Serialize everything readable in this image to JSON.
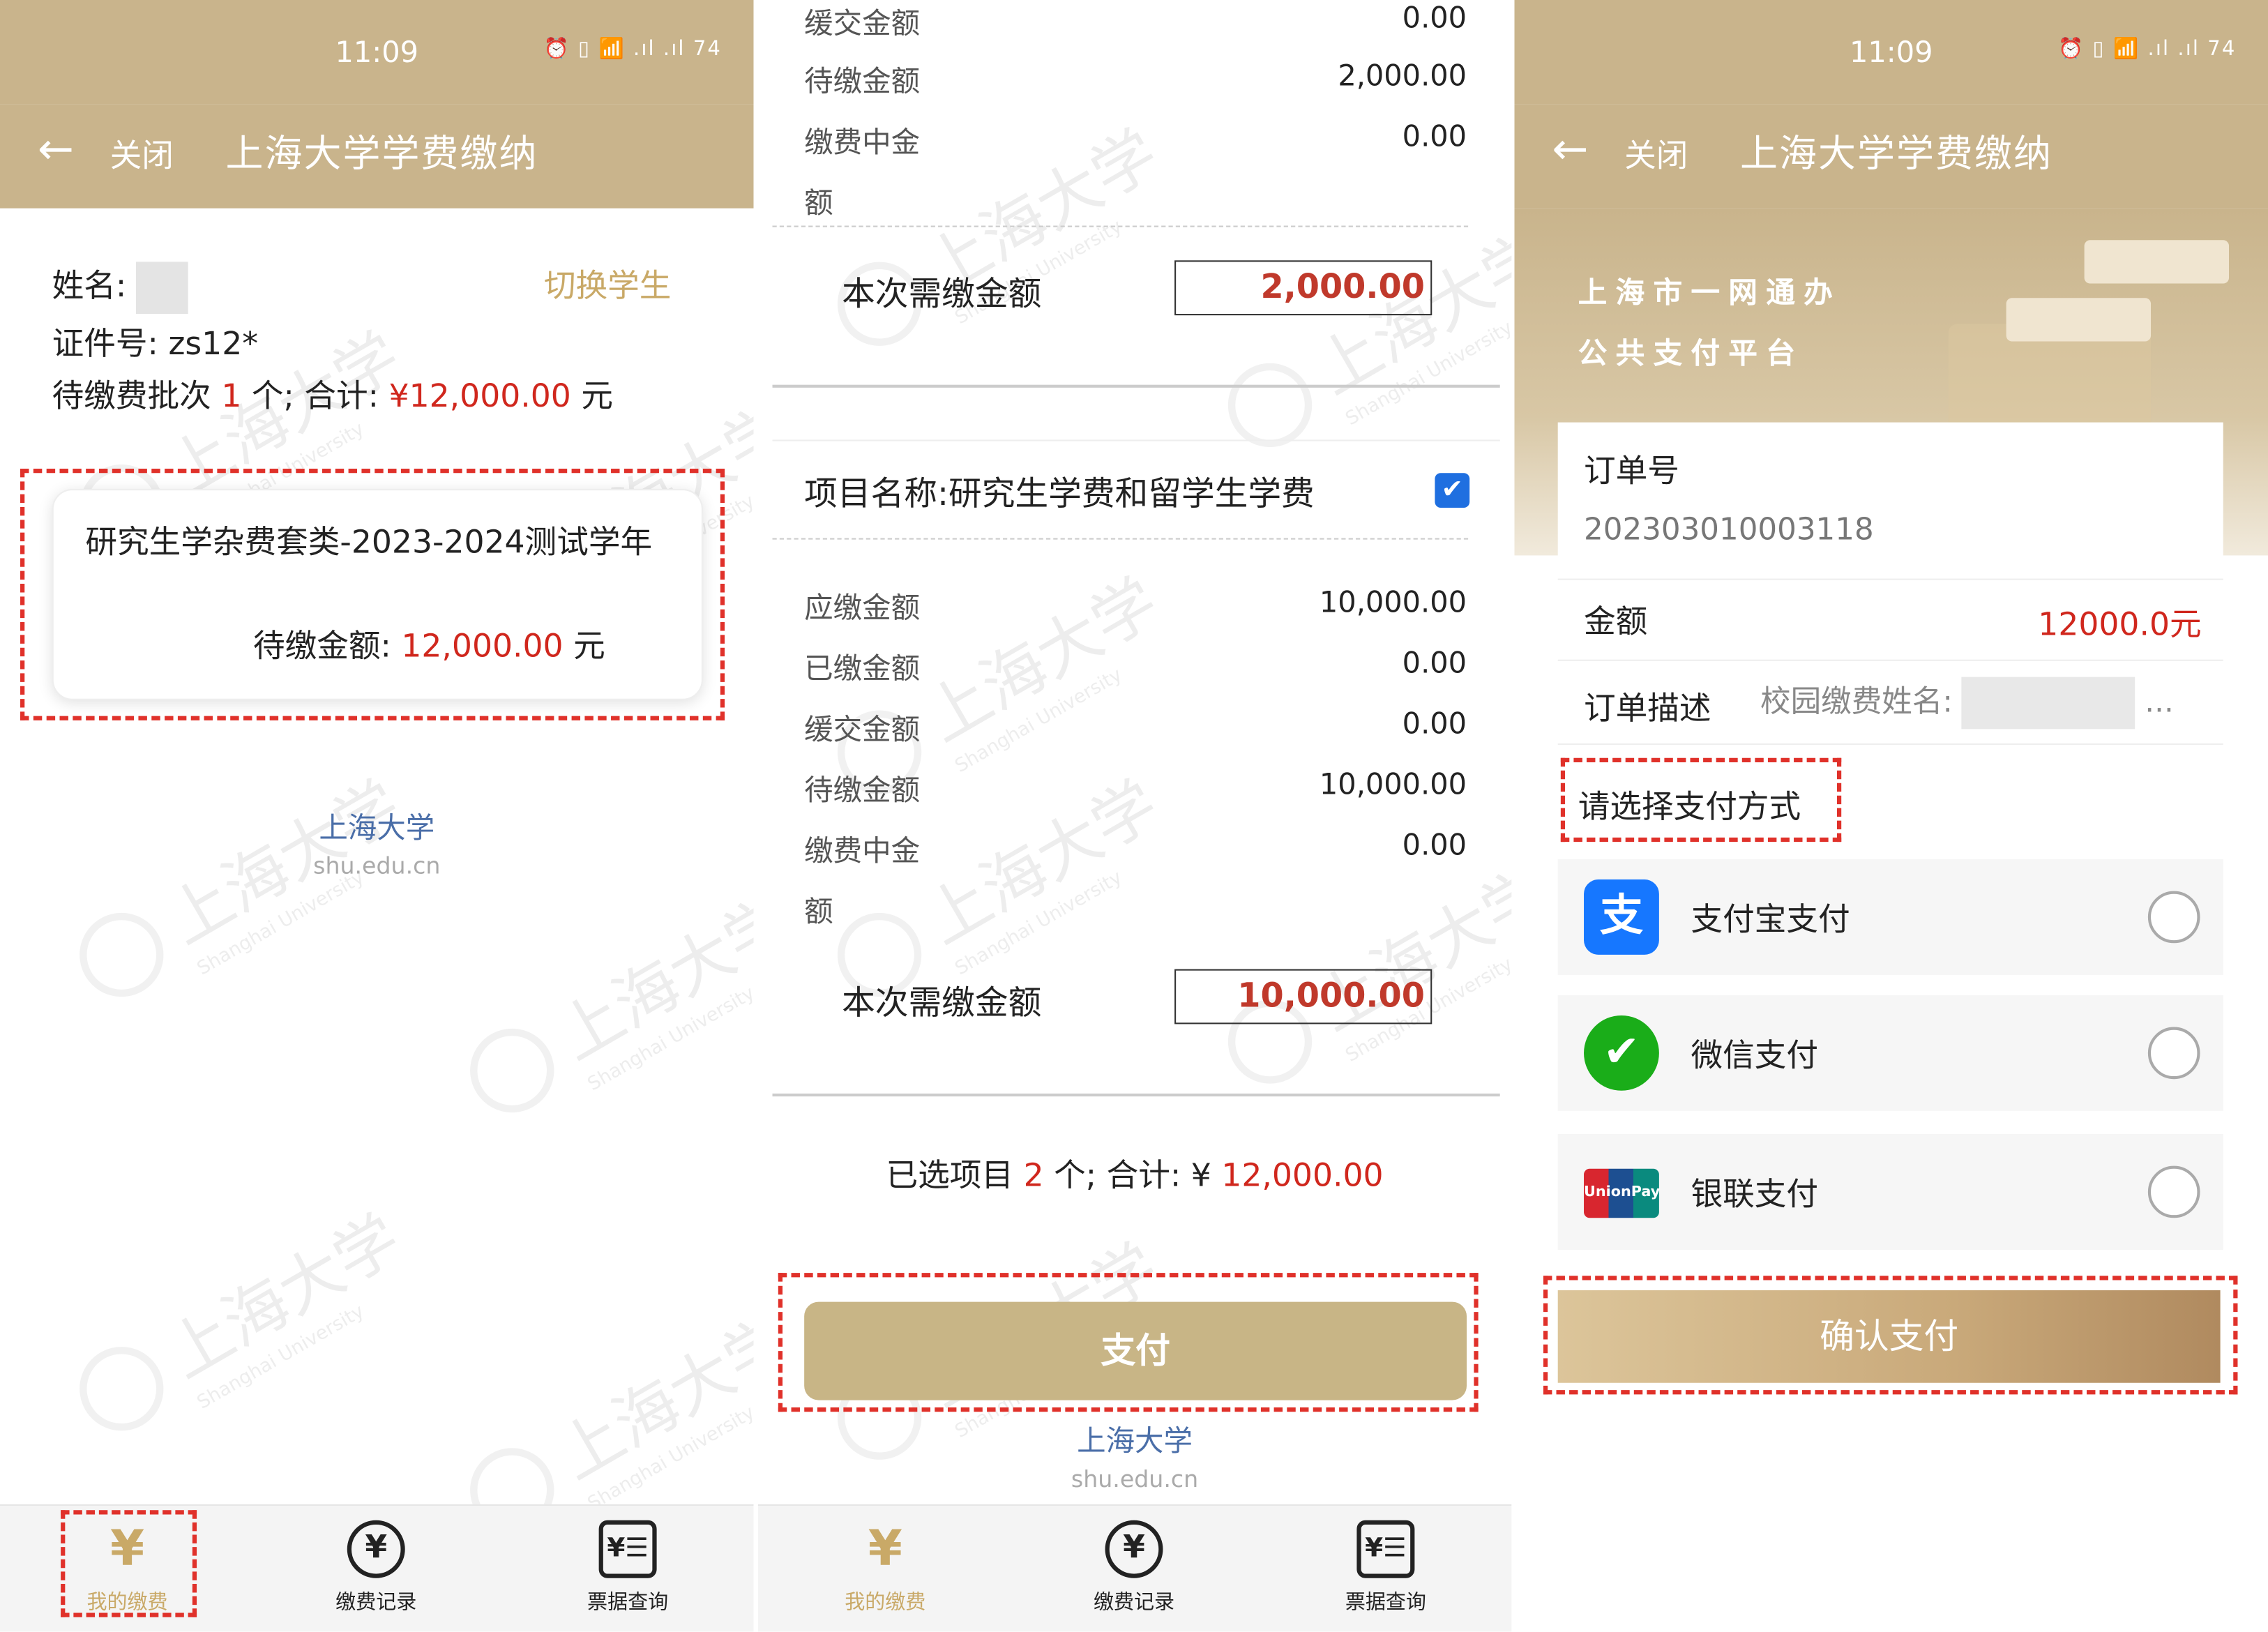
{
  "status": {
    "time": "11:09",
    "icons": "⏰ ▯ 📶 .ıl .ıl 74"
  },
  "nav": {
    "back": "←",
    "close": "关闭",
    "title": "上海大学学费缴纳"
  },
  "watermark": {
    "cn": "上海大学",
    "en": "Shanghai University"
  },
  "school": {
    "name": "上海大学",
    "url": "shu.edu.cn"
  },
  "panel1": {
    "name_label": "姓名:",
    "id_label": "证件号:",
    "id_value": "zs12*",
    "switch": "切换学生",
    "batch_prefix": "待缴费批次",
    "batch_count": "1",
    "batch_mid": "个; 合计:",
    "batch_total": "¥12,000.00",
    "batch_unit": "元",
    "card_title": "研究生学杂费套类-2023-2024测试学年",
    "card_amount_label": "待缴金额:",
    "card_amount": "12,000.00",
    "card_unit": "元"
  },
  "tabs": [
    {
      "label": "我的缴费",
      "icon": "¥"
    },
    {
      "label": "缴费记录",
      "icon": "¥"
    },
    {
      "label": "票据查询",
      "icon": "¥☰"
    }
  ],
  "panel2": {
    "top_rows": [
      {
        "k": "缓交金额",
        "v": "0.00"
      },
      {
        "k": "待缴金额",
        "v": "2,000.00"
      },
      {
        "k": "缴费中金",
        "v": "0.00"
      },
      {
        "k": "额",
        "v": ""
      }
    ],
    "pay_label": "本次需缴金额",
    "pay_value_1": "2,000.00",
    "project": "项目名称:研究生学费和留学生学费",
    "check": "✔",
    "rows": [
      {
        "k": "应缴金额",
        "v": "10,000.00"
      },
      {
        "k": "已缴金额",
        "v": "0.00"
      },
      {
        "k": "缓交金额",
        "v": "0.00"
      },
      {
        "k": "待缴金额",
        "v": "10,000.00"
      },
      {
        "k": "缴费中金",
        "v": "0.00"
      },
      {
        "k": "额",
        "v": ""
      }
    ],
    "pay_value_2": "10,000.00",
    "summary_prefix": "已选项目",
    "summary_count": "2",
    "summary_mid": "个; 合计: ¥",
    "summary_total": "12,000.00",
    "pay_button": "支付"
  },
  "panel3": {
    "banner_line1": "上海市一网通办",
    "banner_line2": "公共支付平台",
    "order_label": "订单号",
    "order_no": "202303010003118",
    "amount_label": "金额",
    "amount_value": "12000.0元",
    "desc_label": "订单描述",
    "desc_value": "校园缴费姓名:",
    "desc_ellipsis": "...",
    "choose": "请选择支付方式",
    "methods": [
      {
        "name": "支付宝支付",
        "icon": "支",
        "color": "#1677ff"
      },
      {
        "name": "微信支付",
        "icon": "✔",
        "color": "#1aad19"
      },
      {
        "name": "银联支付",
        "icon": "UnionPay",
        "color": "#d8262f"
      }
    ],
    "confirm": "确认支付"
  },
  "colors": {
    "gold": "#c9b48c",
    "accent_red": "#d0271d",
    "link_gold": "#c9a967"
  }
}
